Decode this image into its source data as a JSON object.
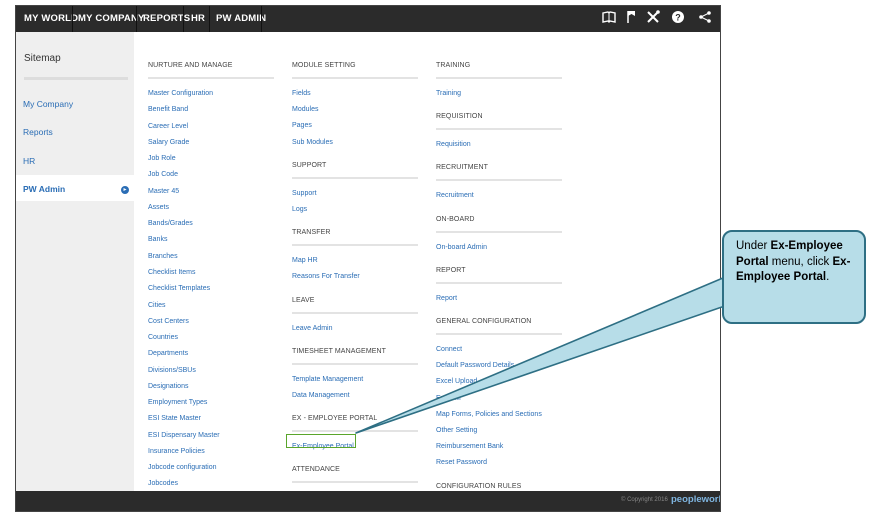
{
  "topnav": [
    "MY WORLD",
    "MY COMPANY",
    "REPORTS",
    "HR",
    "PW ADMIN"
  ],
  "topicons": [
    "book-icon",
    "bookmark-icon",
    "tools-icon",
    "help-icon",
    "share-icon"
  ],
  "sidebar": {
    "title": "Sitemap",
    "items": [
      "My Company",
      "Reports",
      "HR"
    ],
    "active": "PW Admin"
  },
  "col1": {
    "heading": "NURTURE AND MANAGE",
    "links": [
      "Master Configuration",
      "Benefit Band",
      "Career Level",
      "Salary Grade",
      "Job Role",
      "Job Code",
      "Master 45",
      "Assets",
      "Bands/Grades",
      "Banks",
      "Branches",
      "Checklist Items",
      "Checklist Templates",
      "Cities",
      "Cost Centers",
      "Countries",
      "Departments",
      "Divisions/SBUs",
      "Designations",
      "Employment Types",
      "ESI State Master",
      "ESI Dispensary Master",
      "Insurance Policies",
      "Jobcode configuration",
      "Jobcodes"
    ]
  },
  "col2": [
    {
      "heading": "MODULE SETTING",
      "links": [
        "Fields",
        "Modules",
        "Pages",
        "Sub Modules"
      ]
    },
    {
      "heading": "SUPPORT",
      "links": [
        "Support",
        "Logs"
      ]
    },
    {
      "heading": "TRANSFER",
      "links": [
        "Map HR",
        "Reasons For Transfer"
      ]
    },
    {
      "heading": "LEAVE",
      "links": [
        "Leave Admin"
      ]
    },
    {
      "heading": "TIMESHEET MANAGEMENT",
      "links": [
        "Template Management",
        "Data Management"
      ]
    },
    {
      "heading": "EX - EMPLOYEE PORTAL",
      "links": [
        "Ex-Employee Portal"
      ]
    },
    {
      "heading": "ATTENDANCE",
      "links": []
    }
  ],
  "col3": [
    {
      "heading": "TRAINING",
      "links": [
        "Training"
      ]
    },
    {
      "heading": "REQUISITION",
      "links": [
        "Requisition"
      ]
    },
    {
      "heading": "RECRUITMENT",
      "links": [
        "Recruitment"
      ]
    },
    {
      "heading": "ON-BOARD",
      "links": [
        "On-board Admin"
      ]
    },
    {
      "heading": "REPORT",
      "links": [
        "Report"
      ]
    },
    {
      "heading": "GENERAL CONFIGURATION",
      "links": [
        "Connect",
        "Default Password Details",
        "Excel Upload",
        "Excel M",
        "Map Forms, Policies and Sections",
        "Other Setting",
        "Reimbursement Bank",
        "Reset Password"
      ]
    },
    {
      "heading": "CONFIGURATION RULES",
      "links": []
    }
  ],
  "footer": {
    "copyright": "© Copyright 2016",
    "brand": "peopleworks"
  },
  "callout": {
    "p1": "Under ",
    "b1": "Ex-Employee Portal",
    "p2": " menu, click ",
    "b2": "Ex-Employee Portal",
    "p3": "."
  },
  "colors": {
    "topbar": "#2b2b2b",
    "link": "#2a6db5",
    "highlight": "#5aa52b",
    "callout_bg": "#b7dde8",
    "callout_border": "#2e6f84"
  }
}
